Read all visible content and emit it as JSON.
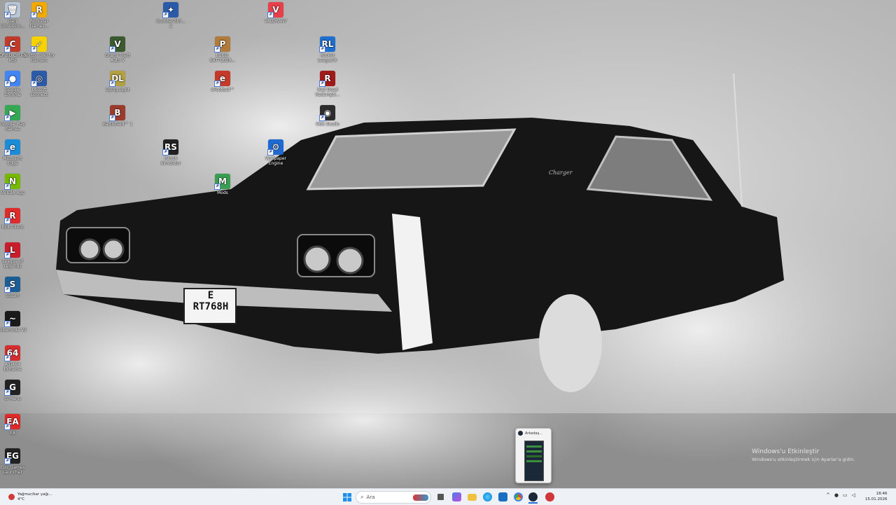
{
  "desktop_icons": [
    {
      "id": "geri-donusum",
      "label": "Geri Dönüşüm...",
      "glyph": "🗑",
      "color": "#b8c6d8"
    },
    {
      "id": "rockstar",
      "label": "Rockstar Games...",
      "glyph": "R",
      "color": "#f2a900"
    },
    {
      "id": "counter-strike",
      "label": "Counter-Stri... 2",
      "glyph": "✦",
      "color": "#2b5aa8"
    },
    {
      "id": "valorant",
      "label": "VALORANT",
      "glyph": "V",
      "color": "#e8404a"
    },
    {
      "id": "cpuid",
      "label": "CPUID CPU-Z MSI",
      "glyph": "C",
      "color": "#c23a2a"
    },
    {
      "id": "norton",
      "label": "Norton 360 for Gamers",
      "glyph": "✓",
      "color": "#f6d200"
    },
    {
      "id": "gta",
      "label": "Grand Theft Auto V",
      "glyph": "V",
      "color": "#3c5a2f"
    },
    {
      "id": "pubg",
      "label": "PUBG: BATTLEGR...",
      "glyph": "P",
      "color": "#b07b3b"
    },
    {
      "id": "rocket-league",
      "label": "Rocket League®",
      "glyph": "RL",
      "color": "#1f6fd1"
    },
    {
      "id": "chrome",
      "label": "Google Chrome",
      "glyph": "●",
      "color": "#4285f4"
    },
    {
      "id": "ubisoft",
      "label": "Ubisoft Connect",
      "glyph": "◎",
      "color": "#2b5aa8"
    },
    {
      "id": "dying-light",
      "label": "Dying Light",
      "glyph": "DL",
      "color": "#b3a040"
    },
    {
      "id": "efootball",
      "label": "eFootball™",
      "glyph": "e",
      "color": "#c43a2a"
    },
    {
      "id": "rdr2",
      "label": "Red Dead Redempti...",
      "glyph": "R",
      "color": "#a11a1a"
    },
    {
      "id": "play-games",
      "label": "Google Play Games",
      "glyph": "▶",
      "color": "#34a853"
    },
    {
      "id": "battlefield",
      "label": "Battlefield™ 1",
      "glyph": "B",
      "color": "#9b3b2c"
    },
    {
      "id": "obs",
      "label": "OBS Studio",
      "glyph": "◉",
      "color": "#2d2d2d"
    },
    {
      "id": "edge",
      "label": "Microsoft Edge",
      "glyph": "e",
      "color": "#1a8cd8"
    },
    {
      "id": "ranch",
      "label": "Ranch Simulator",
      "glyph": "RS",
      "color": "#222222"
    },
    {
      "id": "wallpaper",
      "label": "Wallpaper Engine",
      "glyph": "⚙",
      "color": "#1e6ad2"
    },
    {
      "id": "nvidia",
      "label": "NVIDIA App",
      "glyph": "N",
      "color": "#76b900"
    },
    {
      "id": "mods",
      "label": "Mods",
      "glyph": "M",
      "color": "#3a9e52"
    },
    {
      "id": "riot",
      "label": "Riot Client",
      "glyph": "R",
      "color": "#e02b2b"
    },
    {
      "id": "lol",
      "label": "League of Legends",
      "glyph": "L",
      "color": "#c91d2b"
    },
    {
      "id": "steam",
      "label": "Steam",
      "glyph": "S",
      "color": "#1b5e96"
    },
    {
      "id": "vibemode",
      "label": "Vibemode V3",
      "glyph": "~",
      "color": "#1a1a1a"
    },
    {
      "id": "aida",
      "label": "AIDA64 Extreme",
      "glyph": "64",
      "color": "#d62e2e"
    },
    {
      "id": "gmenu",
      "label": "G-Menu",
      "glyph": "G",
      "color": "#222222"
    },
    {
      "id": "ea",
      "label": "EA",
      "glyph": "EA",
      "color": "#e02a2a"
    },
    {
      "id": "epic",
      "label": "Epic Games Launcher",
      "glyph": "EG",
      "color": "#222222"
    }
  ],
  "wallpaper": {
    "plate_line1": "E",
    "plate_line2": "RT768H",
    "badge": "Charger"
  },
  "preview": {
    "title": "Arkadaş..."
  },
  "watermark": {
    "title": "Windows'u Etkinleştir",
    "subtitle": "Windows'u etkinleştirmek için Ayarlar'a gidin."
  },
  "taskbar": {
    "weather_title": "Yağmur/kar yağı...",
    "weather_temp": "4°C",
    "search_placeholder": "Ara",
    "time": "18:46",
    "date": "15.01.2026",
    "icons": [
      "start",
      "search",
      "widgets",
      "taskview",
      "store",
      "explorer",
      "edge",
      "mail",
      "chrome",
      "steam",
      "riot"
    ]
  }
}
